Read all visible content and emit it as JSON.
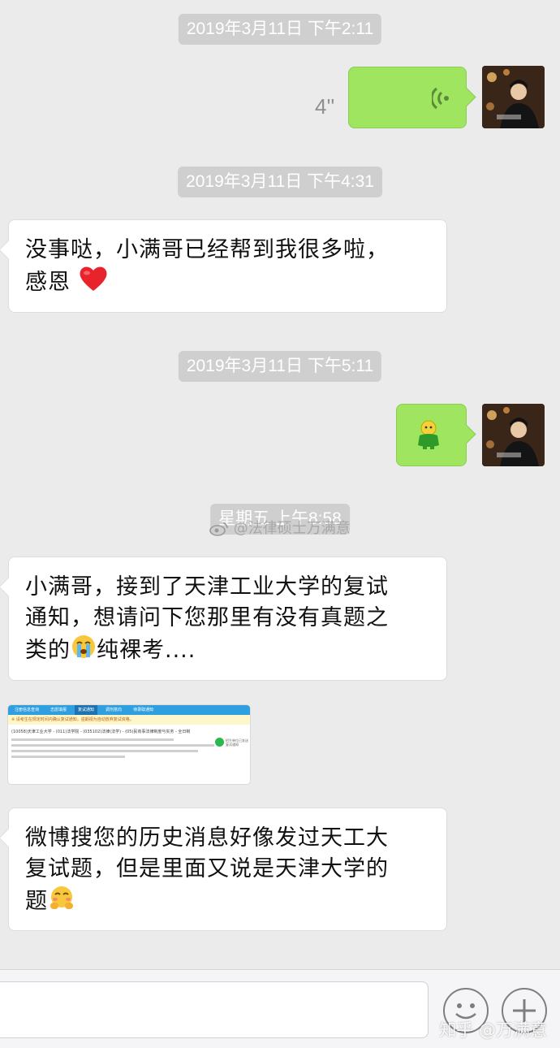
{
  "messages": {
    "ts1": "2019年3月11日 下午2:11",
    "voice_duration": "4''",
    "ts2": "2019年3月11日 下午4:31",
    "msg1": "没事哒，小满哥已经帮到我很多啦，",
    "msg1_line2": "感恩",
    "ts3": "2019年3月11日 下午5:11",
    "ts4": "星期五 上午8:58",
    "msg2_line1": "小满哥，接到了天津工业大学的复试",
    "msg2_line2": "通知，想请问下您那里有没有真题之",
    "msg2_line3a": "类的",
    "msg2_line3b": "纯裸考....",
    "msg3_line1": "微博搜您的历史消息好像发过天工大",
    "msg3_line2": "复试题，但是里面又说是天津大学的",
    "msg3_line3": "题"
  },
  "screenshot_image": {
    "tabs": [
      "注册信息查询",
      "志愿填报",
      "复试通知",
      "调剂意向",
      "待录取通知"
    ],
    "notice": "※ 请考生在规定时间内确认复试通知，逾期视为自动放弃复试资格。",
    "title": "(10058)天津工业大学 - (011)法学院 - (035102)法律(法学) - (05)民商事法律制度与实务 - 全日制",
    "side_text": "招生单位已发送复试通知"
  },
  "watermarks": {
    "center": "@法律硕士万满意",
    "bottom": "知乎 @万满意"
  },
  "colors": {
    "chat_bg": "#ebebeb",
    "outgoing_bubble": "#9fe55f",
    "incoming_bubble": "#ffffff",
    "time_pill": "#cfcfcf"
  },
  "icons": {
    "voice": "voice-wave-icon",
    "heart": "heart-emoji",
    "crying": "crying-emoji",
    "blush": "blush-emoji",
    "sticker": "green-figure-sticker",
    "emoji_button": "smiley-face-icon",
    "plus_button": "plus-icon"
  }
}
